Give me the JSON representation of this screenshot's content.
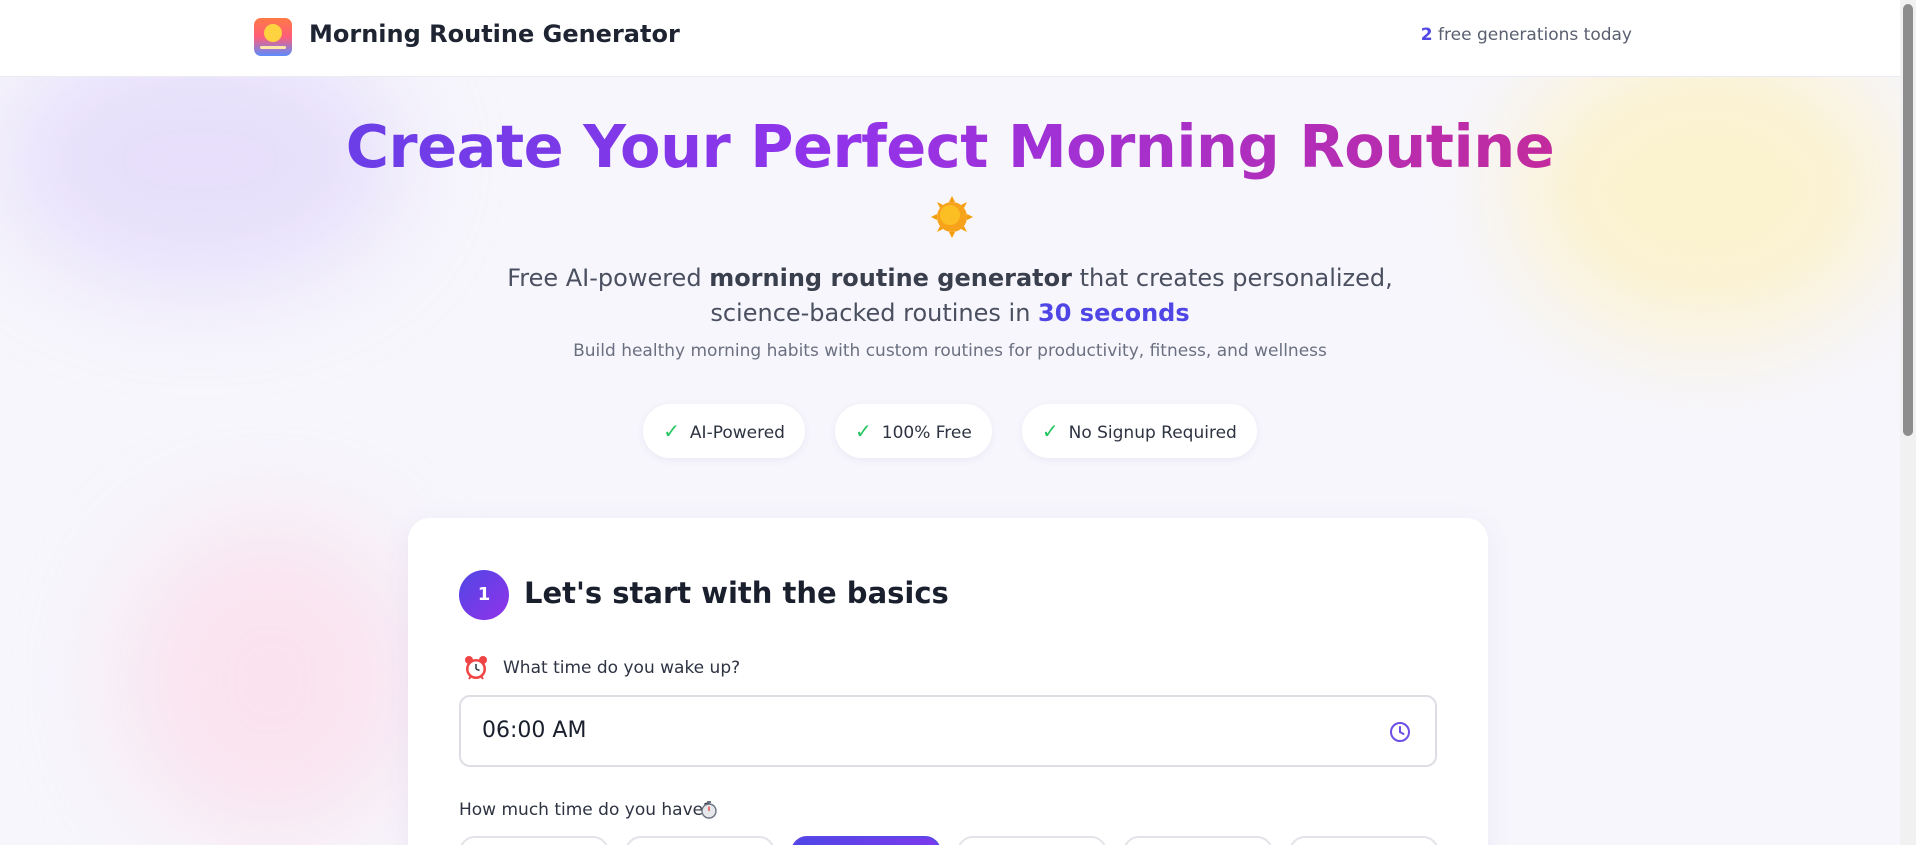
{
  "header": {
    "title": "Morning Routine Generator",
    "gen_count": "2",
    "gen_text": "free generations today"
  },
  "hero": {
    "title": "Create Your Perfect Morning Routine",
    "sub_part1": "Free AI-powered ",
    "sub_bold": "morning routine generator",
    "sub_part2": " that creates personalized,",
    "sub_part3": "science-backed routines in ",
    "sub_highlight": "30 seconds",
    "small": "Build healthy morning habits with custom routines for productivity, fitness, and wellness"
  },
  "badges": [
    {
      "check": "✓",
      "label": "AI-Powered"
    },
    {
      "check": "✓",
      "label": "100% Free"
    },
    {
      "check": "✓",
      "label": "No Signup Required"
    }
  ],
  "card": {
    "step_number": "1",
    "step_title": "Let's start with the basics",
    "wake_label": "What time do you wake up?",
    "wake_value": "06:00 AM",
    "time_label": "How much time do you have?"
  },
  "icons": {
    "logo": "sunrise-logo-icon",
    "hero": "sun-icon",
    "alarm": "alarm-clock-icon",
    "clock": "clock-icon",
    "stopwatch": "stopwatch-icon"
  },
  "colors": {
    "accent": "#4f46e5",
    "gradient_start": "#4f46e5",
    "gradient_mid": "#9333ea",
    "gradient_end": "#db2777",
    "check": "#22c55e"
  }
}
